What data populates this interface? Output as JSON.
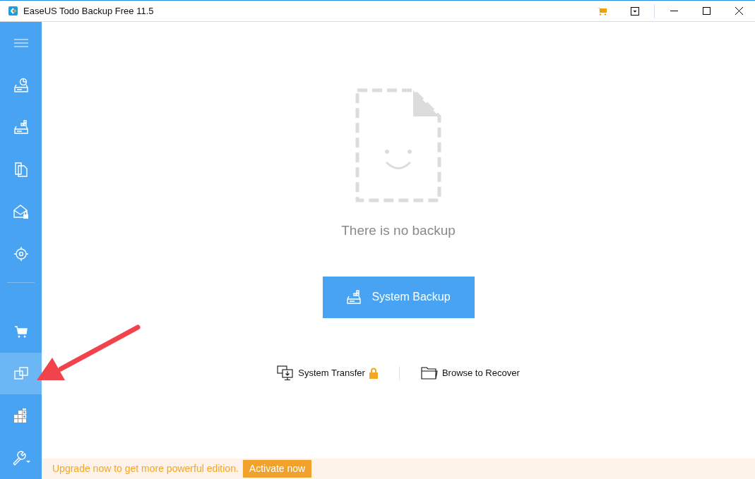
{
  "window": {
    "title": "EaseUS Todo Backup Free 11.5"
  },
  "sidebar": {
    "top_items": [
      {
        "selected": false
      },
      {
        "selected": false
      },
      {
        "selected": false
      },
      {
        "selected": false
      },
      {
        "selected": false
      },
      {
        "selected": false
      }
    ],
    "bottom_items": [
      {
        "selected": false
      },
      {
        "selected": true
      },
      {
        "selected": false
      },
      {
        "selected": false
      }
    ]
  },
  "empty_state": {
    "message": "There is no backup"
  },
  "primary_button": {
    "label": "System Backup"
  },
  "links": [
    {
      "label": "System Transfer",
      "locked": true
    },
    {
      "label": "Browse to Recover",
      "locked": false
    }
  ],
  "upgrade_bar": {
    "message": "Upgrade now to get more powerful edition.",
    "button": "Activate now"
  }
}
